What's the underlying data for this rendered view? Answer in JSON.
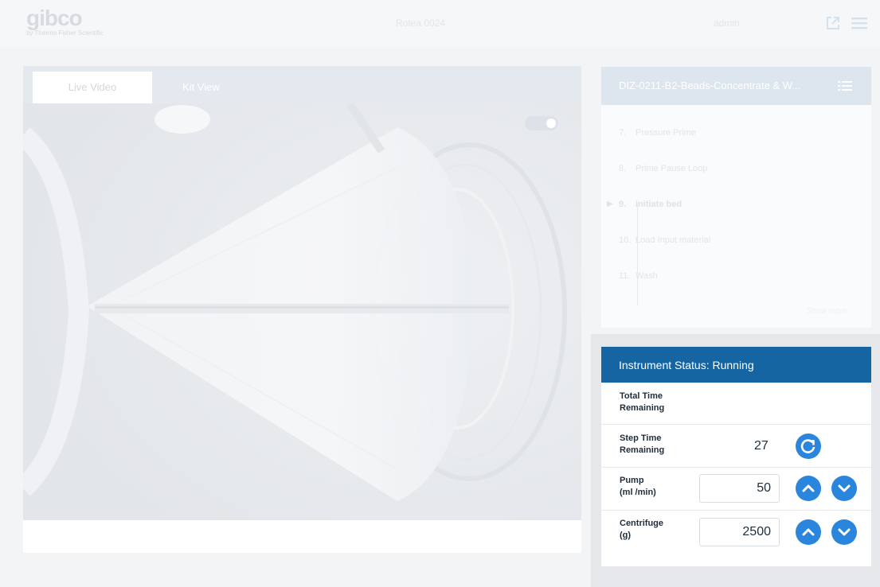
{
  "header": {
    "logo_text": "gibco",
    "logo_subtext": "by Thermo Fisher Scientific",
    "instrument_name": "Rotea 0024",
    "user_name": "admin"
  },
  "video": {
    "tabs": [
      {
        "label": "Live Video",
        "active": true
      },
      {
        "label": "Kit View",
        "active": false
      }
    ]
  },
  "protocol": {
    "title": "DIZ-0211-B2-Beads-Concentrate & W...",
    "steps": [
      {
        "number": "7.",
        "label": "Pressure Prime",
        "current": false
      },
      {
        "number": "8.",
        "label": "Prime Pause Loop",
        "current": false
      },
      {
        "number": "9.",
        "label": "Initiate bed",
        "current": true
      },
      {
        "number": "10.",
        "label": "Load Input material",
        "current": false
      },
      {
        "number": "11.",
        "label": "Wash",
        "current": false
      }
    ],
    "show_more": "Show more"
  },
  "status": {
    "title": "Instrument Status: Running",
    "total_time_label_1": "Total Time",
    "total_time_label_2": "Remaining",
    "step_time_label_1": "Step Time",
    "step_time_label_2": "Remaining",
    "step_time_value": "27",
    "pump_label_1": "Pump",
    "pump_label_2": "(ml /min)",
    "pump_value": "50",
    "centrifuge_label_1": "Centrifuge",
    "centrifuge_label_2": "(g)",
    "centrifuge_value": "2500"
  },
  "colors": {
    "status_header": "#1565a3",
    "accent_button": "#2a85dd"
  },
  "icons": {
    "export": "export-icon",
    "menu": "hamburger-menu-icon",
    "protocol_list": "list-icon",
    "reset": "refresh-icon",
    "increase": "chevron-up-icon",
    "decrease": "chevron-down-icon"
  }
}
